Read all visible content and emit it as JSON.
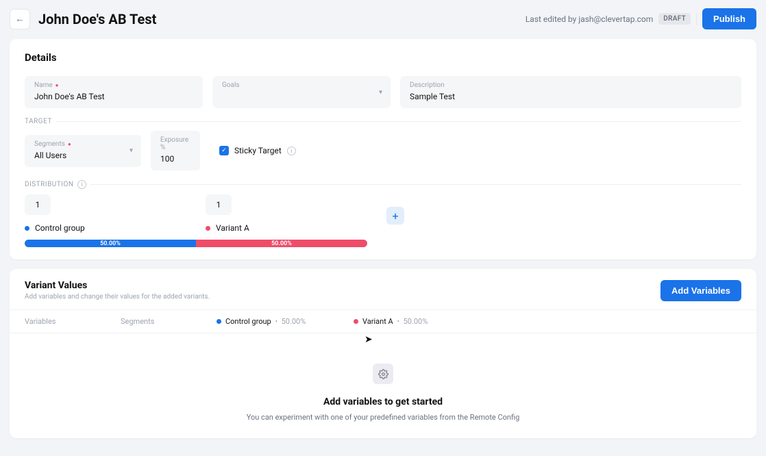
{
  "header": {
    "page_title": "John Doe's AB Test",
    "last_edited": "Last edited by jash@clevertap.com",
    "status_badge": "DRAFT",
    "publish_label": "Publish"
  },
  "details": {
    "section_title": "Details",
    "name_label": "Name",
    "name_value": "John Doe's AB Test",
    "goals_label": "Goals",
    "goals_value": "",
    "description_label": "Description",
    "description_value": "Sample Test",
    "target_heading": "TARGET",
    "segments_label": "Segments",
    "segments_value": "All Users",
    "exposure_label": "Exposure %",
    "exposure_value": "100",
    "sticky_target_label": "Sticky Target",
    "sticky_target_checked": true,
    "distribution_heading": "DISTRIBUTION",
    "variants": [
      {
        "weight": "1",
        "name": "Control group",
        "dot": "blue",
        "percent": "50.00%"
      },
      {
        "weight": "1",
        "name": "Variant A",
        "dot": "pink",
        "percent": "50.00%"
      }
    ]
  },
  "variant_values": {
    "title": "Variant Values",
    "subtitle": "Add variables and change their values for the added variants.",
    "add_button": "Add Variables",
    "columns": {
      "variables": "Variables",
      "segments": "Segments",
      "control_group": "Control group",
      "control_group_pct": "50.00%",
      "variant_a": "Variant A",
      "variant_a_pct": "50.00%"
    },
    "empty_title": "Add variables to get started",
    "empty_subtitle": "You can experiment with one of your predefined variables from the Remote Config"
  },
  "colors": {
    "blue": "#1a73e8",
    "pink": "#ef4c6a"
  }
}
